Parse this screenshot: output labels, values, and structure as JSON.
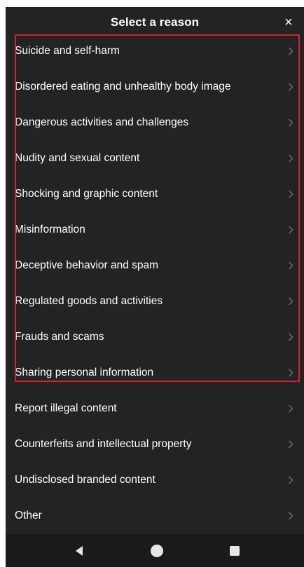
{
  "header": {
    "title": "Select a reason",
    "close_glyph": "×"
  },
  "reasons": [
    {
      "label": "Suicide and self-harm"
    },
    {
      "label": "Disordered eating and unhealthy body image"
    },
    {
      "label": "Dangerous activities and challenges"
    },
    {
      "label": "Nudity and sexual content"
    },
    {
      "label": "Shocking and graphic content"
    },
    {
      "label": "Misinformation"
    },
    {
      "label": "Deceptive behavior and spam"
    },
    {
      "label": "Regulated goods and activities"
    },
    {
      "label": "Frauds and scams"
    },
    {
      "label": "Sharing personal information"
    },
    {
      "label": "Report illegal content"
    },
    {
      "label": "Counterfeits and intellectual property"
    },
    {
      "label": "Undisclosed branded content"
    },
    {
      "label": "Other"
    }
  ],
  "icons": {
    "close": "close-icon",
    "chevron": "chevron-right-icon",
    "back": "back-triangle-icon",
    "home": "home-circle-icon",
    "recents": "recents-square-icon"
  },
  "colors": {
    "background": "#232323",
    "text": "#ffffff",
    "chevron": "#6e6e6e",
    "highlight": "#d9202b",
    "navbar": "#1a1a1a"
  }
}
